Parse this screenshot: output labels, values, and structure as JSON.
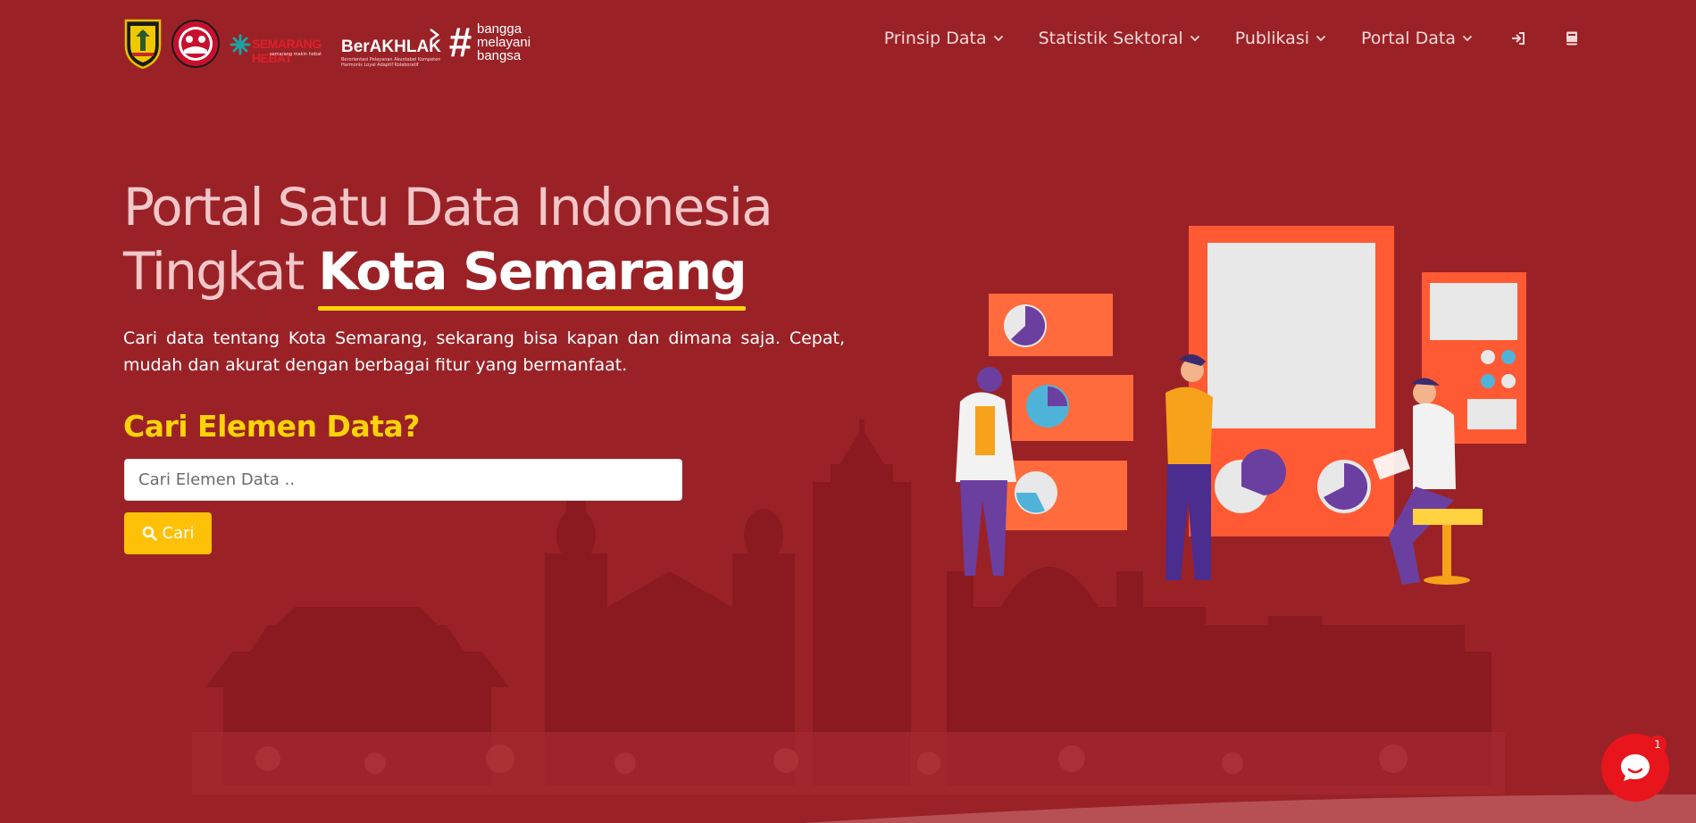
{
  "brand": {
    "logo_pemkot": "pemkot-semarang-logo",
    "logo_circle": "semarang-circle-logo",
    "logo_sd": "semarang-hebat-logo",
    "berakhlak": {
      "title": "BerAKHLAK",
      "tagline": "Berorientasi Pelayanan Akuntabel Kompeten Harmonis Loyal Adaptif Kolaboratif"
    },
    "bangga": [
      "bangga",
      "melayani",
      "bangsa"
    ]
  },
  "nav": {
    "items": [
      {
        "label": "Prinsip Data"
      },
      {
        "label": "Statistik Sektoral"
      },
      {
        "label": "Publikasi"
      },
      {
        "label": "Portal Data"
      }
    ],
    "icons": [
      "sign-in-icon",
      "book-icon"
    ]
  },
  "hero": {
    "title_line1": "Portal Satu Data Indonesia",
    "title_line2_prefix": "Tingkat ",
    "title_line2_highlight": "Kota Semarang",
    "description": "Cari data tentang Kota Semarang, sekarang bisa kapan dan dimana saja. Cepat, mudah dan akurat dengan berbagai fitur yang bermanfaat."
  },
  "search": {
    "heading": "Cari Elemen Data?",
    "placeholder": "Cari Elemen Data ..",
    "button_label": "Cari"
  },
  "chat": {
    "badge_count": "1"
  },
  "colors": {
    "background": "#9a2227",
    "accent_yellow": "#ffd20a",
    "button_yellow": "#ffc107",
    "chat_red": "#e8151c"
  }
}
